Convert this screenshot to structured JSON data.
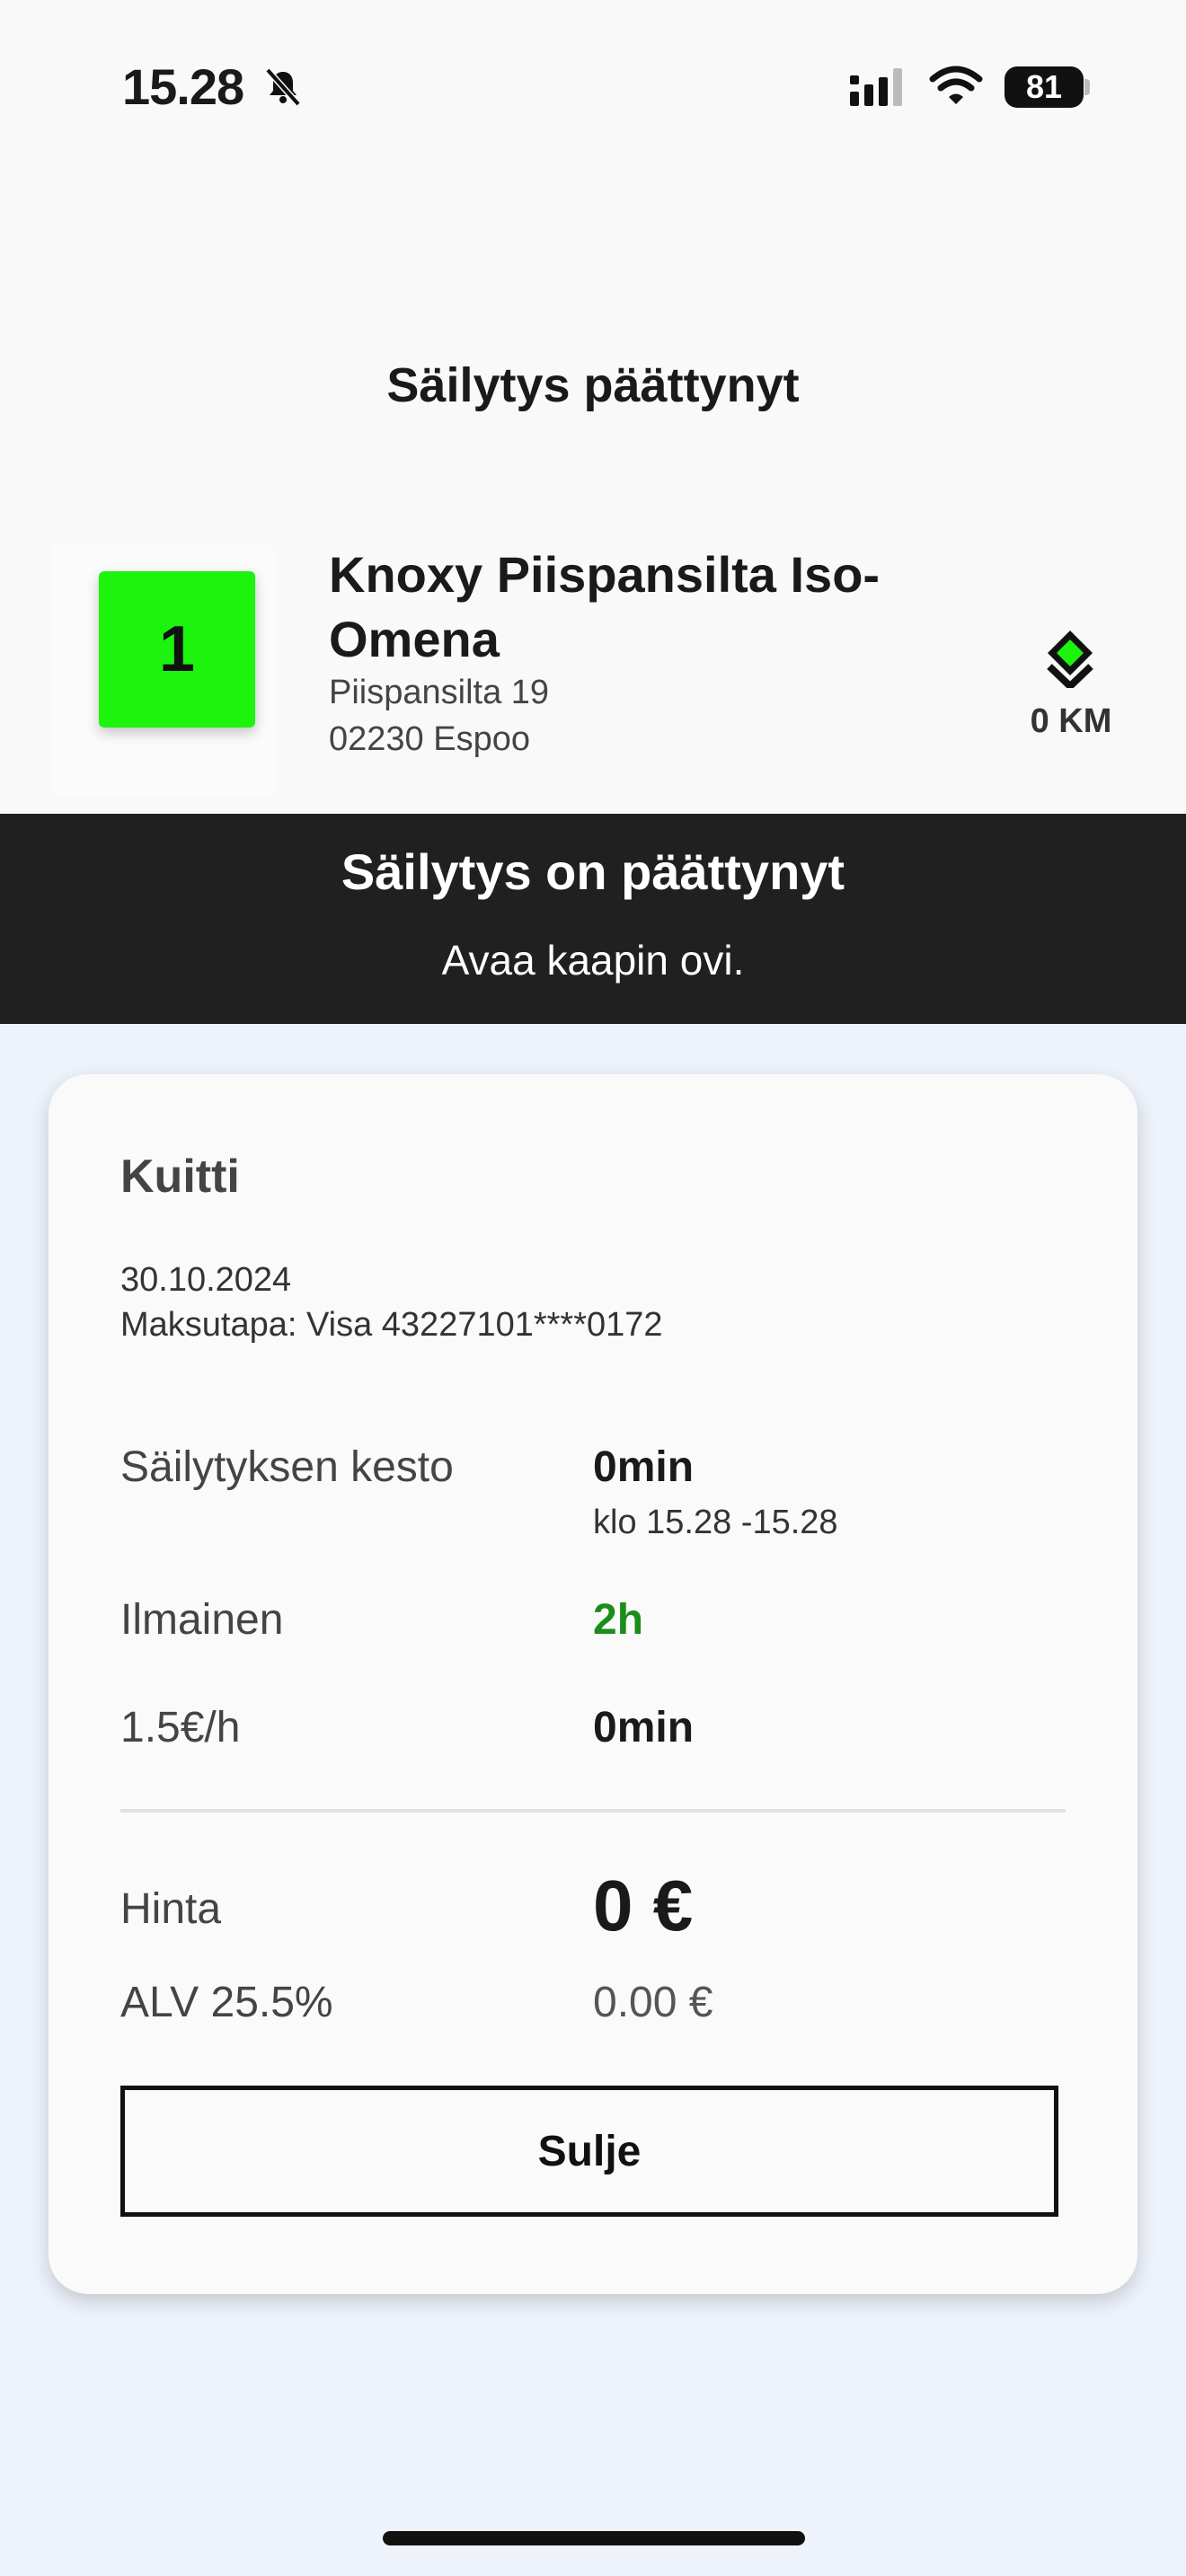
{
  "status_bar": {
    "time": "15.28",
    "battery": "81"
  },
  "header": {
    "title": "Säilytys päättynyt"
  },
  "location": {
    "locker_number": "1",
    "name": "Knoxy Piispansilta Iso-Omena",
    "street": "Piispansilta 19",
    "city": "02230 Espoo",
    "distance": "0 KM",
    "badge_color": "#1cf40e"
  },
  "banner": {
    "title": "Säilytys on päättynyt",
    "subtitle": "Avaa kaapin ovi."
  },
  "receipt": {
    "title": "Kuitti",
    "date": "30.10.2024",
    "payment": "Maksutapa: Visa 43227101****0172",
    "rows": [
      {
        "label": "Säilytyksen kesto",
        "value": "0min",
        "detail": "klo 15.28 -15.28"
      },
      {
        "label": "Ilmainen",
        "value": "2h"
      },
      {
        "label": "1.5€/h",
        "value": "0min"
      }
    ],
    "price_label": "Hinta",
    "price_value": "0 €",
    "vat_label": "ALV 25.5%",
    "vat_value": "0.00 €",
    "close_label": "Sulje"
  },
  "colors": {
    "banner_bg": "#202020",
    "free_text": "#1b8d1b",
    "nav_icon": "#1cf40e"
  }
}
